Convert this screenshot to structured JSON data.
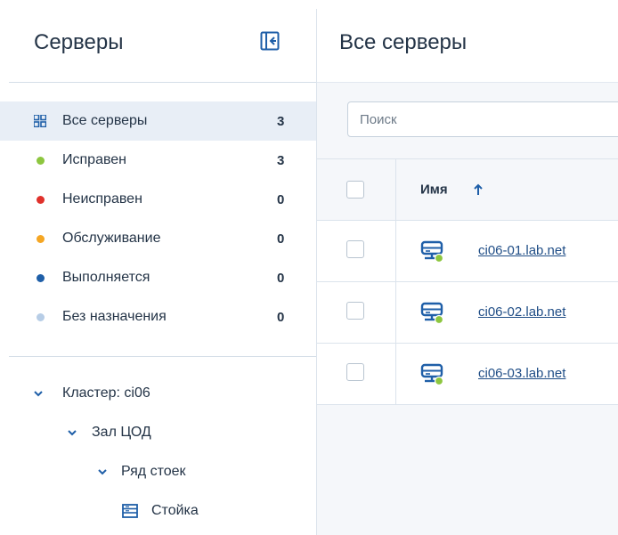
{
  "sidebar": {
    "title": "Серверы",
    "status_items": [
      {
        "label": "Все серверы",
        "count": "3",
        "icon": "grid-icon",
        "color": "#1f5fa8"
      },
      {
        "label": "Исправен",
        "count": "3",
        "icon": "dot",
        "color": "#8dc63f"
      },
      {
        "label": "Неисправен",
        "count": "0",
        "icon": "dot",
        "color": "#e0312b"
      },
      {
        "label": "Обслуживание",
        "count": "0",
        "icon": "dot",
        "color": "#f5a623"
      },
      {
        "label": "Выполняется",
        "count": "0",
        "icon": "dot",
        "color": "#1f5fa8"
      },
      {
        "label": "Без назначения",
        "count": "0",
        "icon": "dot",
        "color": "#b7cde6"
      }
    ],
    "tree": [
      {
        "label": "Кластер: ci06",
        "icon": "chevron-down-icon"
      },
      {
        "label": "Зал ЦОД",
        "icon": "chevron-down-icon"
      },
      {
        "label": "Ряд стоек",
        "icon": "chevron-down-icon"
      },
      {
        "label": "Стойка",
        "icon": "rack-icon"
      }
    ]
  },
  "main": {
    "title": "Все серверы",
    "search": {
      "placeholder": "Поиск"
    },
    "table": {
      "columns": [
        "Имя"
      ],
      "sort": "ascending",
      "rows": [
        {
          "name": "ci06-01.lab.net",
          "status_color": "#8dc63f"
        },
        {
          "name": "ci06-02.lab.net",
          "status_color": "#8dc63f"
        },
        {
          "name": "ci06-03.lab.net",
          "status_color": "#8dc63f"
        }
      ]
    }
  },
  "colors": {
    "accent": "#1f5fa8",
    "link": "#1f4d86",
    "active_bg": "#e8eef6"
  }
}
